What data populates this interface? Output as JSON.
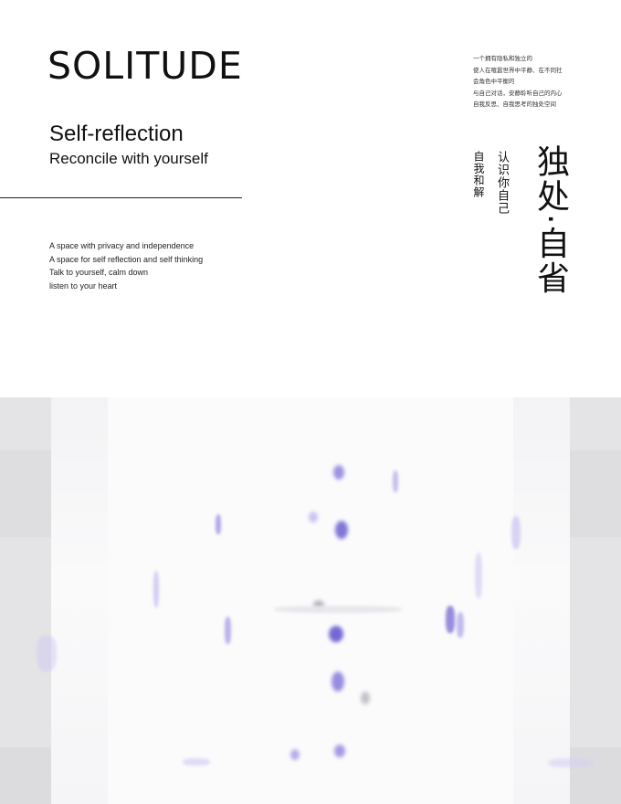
{
  "title": "SOLITUDE",
  "subtitle": "Self-reflection",
  "tagline": "Reconcile with yourself",
  "description_lines": [
    "A space with privacy and independence",
    "A space for self reflection and self thinking",
    "Talk to yourself, calm down",
    "listen to your heart"
  ],
  "cn_paragraph": [
    "一个拥有隐私和独立的",
    "使人在喧嚣世界中平静、在不同社",
    "会角色中平衡的",
    "与自己对话，安静聆听自己的内心",
    "自我反思、自我思考的独处空间"
  ],
  "cn_vertical_small_1": "自我和解",
  "cn_vertical_small_2": "认识你自己",
  "cn_vertical_large": "独处·自省",
  "colors": {
    "text": "#111111",
    "panel_gray": "#e4e4e6",
    "accent_violet": "#6a4fd8"
  }
}
